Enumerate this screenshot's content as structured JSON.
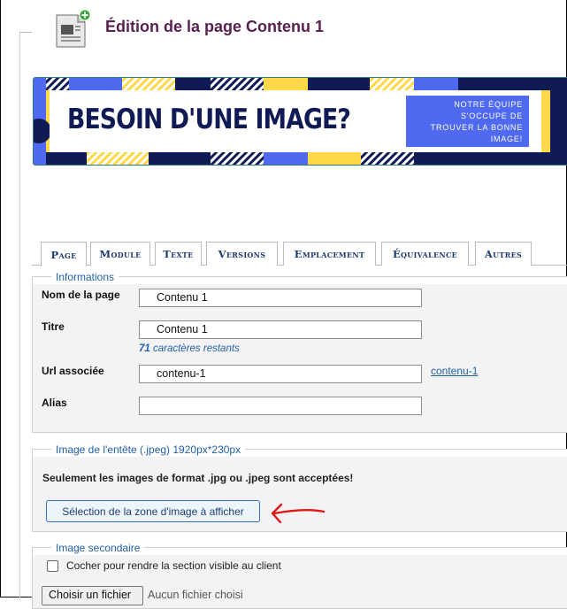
{
  "header": {
    "title": "Édition de la page Contenu 1",
    "icon": "page-add-icon"
  },
  "banner": {
    "title": "BESOIN D'UNE IMAGE?",
    "box_lines": [
      "NOTRE ÉQUIPE",
      "S'OCCUPE DE",
      "TROUVER LA BONNE",
      "IMAGE!"
    ],
    "colors": {
      "navy": "#101a55",
      "blue": "#4f6af0",
      "yellow": "#ffd84a"
    }
  },
  "tabs": [
    {
      "label": "Page",
      "active": true
    },
    {
      "label": "Module"
    },
    {
      "label": "Texte"
    },
    {
      "label": "Versions"
    },
    {
      "label": "Emplacement"
    },
    {
      "label": "Équivalence"
    },
    {
      "label": "Autres"
    }
  ],
  "informations": {
    "legend": "Informations",
    "nom_label": "Nom de la page",
    "nom_value": "Contenu 1",
    "titre_label": "Titre",
    "titre_value": "Contenu 1",
    "titre_hint_count": "71",
    "titre_hint_text": " caractères restants",
    "url_label": "Url associée",
    "url_value": "contenu-1",
    "url_link": "contenu-1",
    "alias_label": "Alias",
    "alias_value": ""
  },
  "image_entete": {
    "legend": "Image de l'entête (.jpeg) 1920px*230px",
    "note": "Seulement les images de format .jpg ou .jpeg sont acceptées!",
    "button_label": "Sélection de la zone d'image à afficher",
    "annotation": "red-arrow-icon"
  },
  "image_secondaire": {
    "legend": "Image secondaire",
    "checkbox_label": "Cocher pour rendre la section visible au client",
    "checked": false,
    "file_button": "Choisir un fichier",
    "file_status": "Aucun fichier choisi"
  }
}
